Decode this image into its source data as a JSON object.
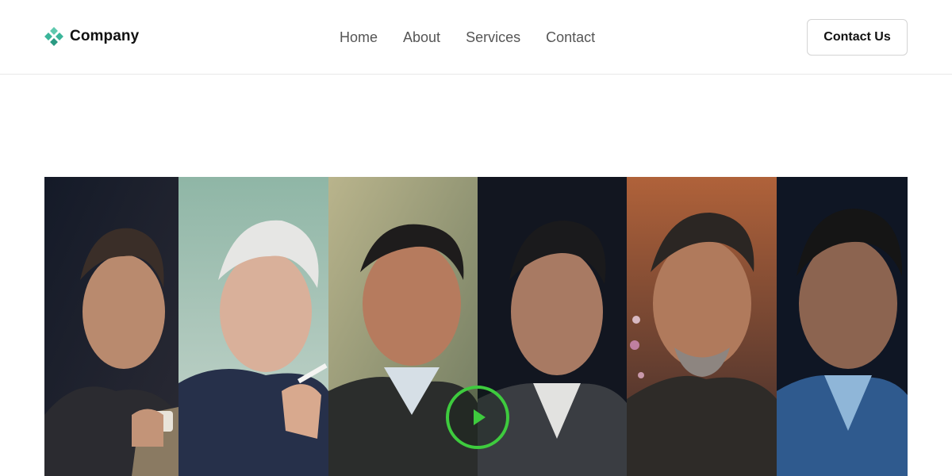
{
  "header": {
    "brand_name": "Company",
    "brand_icon": "diamond-logo-icon",
    "brand_color": "#3bb59a",
    "nav": [
      {
        "label": "Home"
      },
      {
        "label": "About"
      },
      {
        "label": "Services"
      },
      {
        "label": "Contact"
      }
    ],
    "cta_label": "Contact Us"
  },
  "hero": {
    "media": "video-thumbnail",
    "panel_count": 6,
    "play_icon": "play-icon",
    "play_color": "#3ecb3e"
  }
}
